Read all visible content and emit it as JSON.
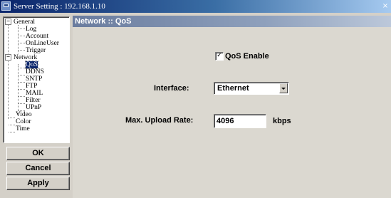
{
  "window": {
    "title": "Server Setting : 192.168.1.10",
    "close_glyph": "×"
  },
  "tree": {
    "collapse_glyph": "−",
    "nodes": [
      {
        "label": "General",
        "icon": "collapse-icon"
      },
      {
        "label": "Log"
      },
      {
        "label": "Account"
      },
      {
        "label": "OnLineUser"
      },
      {
        "label": "Trigger"
      },
      {
        "label": "Network",
        "icon": "collapse-icon"
      },
      {
        "label": "QoS",
        "selected": true
      },
      {
        "label": "DDNS"
      },
      {
        "label": "SNTP"
      },
      {
        "label": "FTP"
      },
      {
        "label": "MAIL"
      },
      {
        "label": "Filter"
      },
      {
        "label": "UPnP"
      },
      {
        "label": "Video"
      },
      {
        "label": "Color"
      },
      {
        "label": "Time"
      }
    ]
  },
  "buttons": {
    "ok": "OK",
    "cancel": "Cancel",
    "apply": "Apply"
  },
  "panel": {
    "section_title": "Network :: QoS",
    "qos_enable": {
      "label": "QoS Enable",
      "checked": true,
      "check_glyph": "✓"
    },
    "interface": {
      "label": "Interface:",
      "value": "Ethernet"
    },
    "upload": {
      "label": "Max. Upload Rate:",
      "value": "4096",
      "unit": "kbps"
    }
  }
}
